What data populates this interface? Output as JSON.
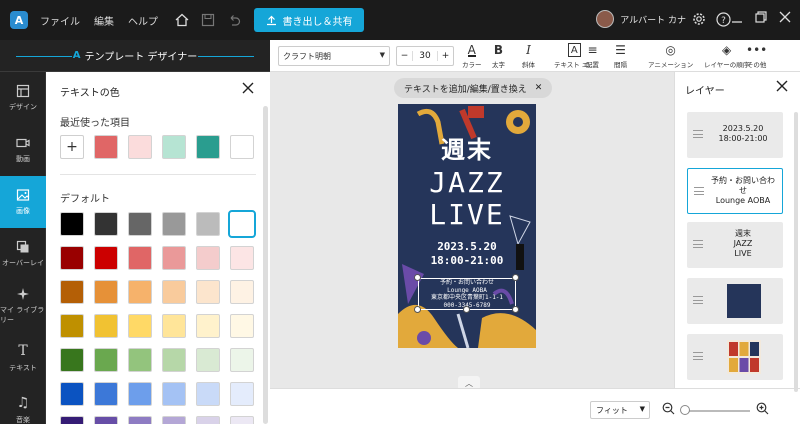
{
  "menu": {
    "file": "ファイル",
    "edit": "編集",
    "help": "ヘルプ"
  },
  "export_button": "書き出し＆共有",
  "user": {
    "name": "アルバート カナ"
  },
  "designer_header": "テンプレート デザイナー",
  "leftbar": [
    {
      "label": "デザイン",
      "icon": "design-icon"
    },
    {
      "label": "動画",
      "icon": "video-icon"
    },
    {
      "label": "画像",
      "icon": "image-icon",
      "active": true
    },
    {
      "label": "オーバーレイ",
      "icon": "overlay-icon"
    },
    {
      "label": "マイ ライブラリー",
      "icon": "library-icon"
    },
    {
      "label": "テキスト",
      "icon": "text-icon"
    },
    {
      "label": "音楽",
      "icon": "music-icon"
    }
  ],
  "color_panel": {
    "title": "テキストの色",
    "recent_label": "最近使った項目",
    "add_label": "+",
    "recent": [
      "#e06666",
      "#fbdcdc",
      "#b6e4d3",
      "#2a9d8f",
      "#ffffff"
    ],
    "default_label": "デフォルト",
    "default_rows": [
      [
        "#000000",
        "#333333",
        "#666666",
        "#999999",
        "#bbbbbb",
        "#ffffff"
      ],
      [
        "#990000",
        "#cc0000",
        "#e06666",
        "#ea9999",
        "#f4cccc",
        "#fce5e5"
      ],
      [
        "#b45f06",
        "#e69138",
        "#f6b26b",
        "#f9cb9c",
        "#fce5cd",
        "#fef2e4"
      ],
      [
        "#bf9000",
        "#f1c232",
        "#ffd966",
        "#ffe599",
        "#fff2cc",
        "#fff8e5"
      ],
      [
        "#38761d",
        "#6aa84f",
        "#93c47d",
        "#b6d7a8",
        "#d9ead3",
        "#ecf5e9"
      ],
      [
        "#0b53c1",
        "#3c78d8",
        "#6d9eeb",
        "#a4c2f4",
        "#c9daf8",
        "#e4ecfc"
      ],
      [
        "#351c75",
        "#674ea7",
        "#8e7cc3",
        "#b4a7d6",
        "#d9d2e9",
        "#ece8f4"
      ]
    ]
  },
  "toolbar": {
    "font": "クラフト明朝",
    "minus": "−",
    "size": "30",
    "plus": "+",
    "tools": [
      {
        "label": "カラー",
        "glyph": "A",
        "icon": "text-color-icon"
      },
      {
        "label": "太字",
        "glyph": "B",
        "icon": "bold-icon"
      },
      {
        "label": "斜体",
        "glyph": "I",
        "icon": "italic-icon"
      },
      {
        "label": "テキスト エ...",
        "glyph": "A",
        "icon": "text-effect-icon"
      },
      {
        "label": "配置",
        "glyph": "≡",
        "icon": "align-icon"
      },
      {
        "label": "間隔",
        "glyph": "☰",
        "icon": "spacing-icon"
      },
      {
        "label": "アニメーション",
        "glyph": "◎",
        "icon": "animation-icon"
      },
      {
        "label": "レイヤーの順序",
        "glyph": "◈",
        "icon": "layer-order-icon"
      },
      {
        "label": "その他",
        "glyph": "•••",
        "icon": "more-icon"
      }
    ]
  },
  "canvas": {
    "hint": "テキストを追加/編集/置き換え",
    "poster": {
      "line1": "週末",
      "line2": "JAZZ",
      "line3": "LIVE",
      "date": "2023.5.20",
      "time": "18:00-21:00",
      "selected_lines": [
        "予約・お問い合わせ",
        "Lounge AOBA",
        "東京都中央区青葉町1-1-1",
        "000-3345-6789"
      ]
    },
    "colors": {
      "navy": "#25355a",
      "accent": "#15a6d8"
    }
  },
  "bottom": {
    "fit": "フィット"
  },
  "layers": {
    "title": "レイヤー",
    "items": [
      {
        "lines": [
          "2023.5.20",
          "18:00-21:00"
        ]
      },
      {
        "lines": [
          "予約・お問い合わ",
          "せ",
          "Lounge AOBA"
        ],
        "active": true
      },
      {
        "lines": [
          "週末",
          "JAZZ",
          "LIVE"
        ]
      }
    ]
  }
}
